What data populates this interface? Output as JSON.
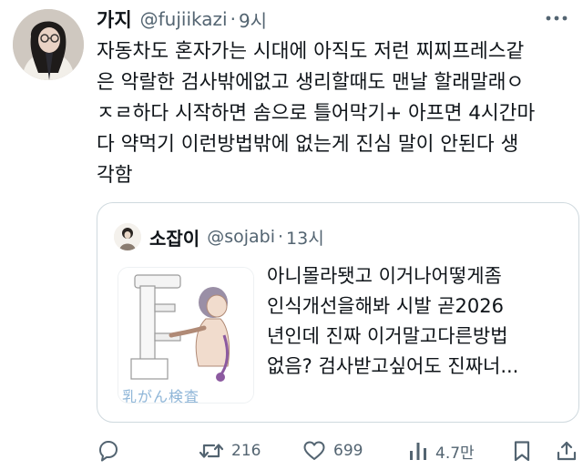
{
  "tweet": {
    "display_name": "가지",
    "handle": "@fujiikazi",
    "separator": "·",
    "time": "9시",
    "text": "자동차도 혼자가는 시대에 아직도 저런 찌찌프레스같\n은 악랄한 검사밖에없고 생리할때도 맨날 할래말래ㅇ\nㅈㄹ하다 시작하면 솜으로 틀어막기+ 아프면 4시간마\n다 약먹기 이런방법밖에 없는게 진심 말이 안된다 생\n각함"
  },
  "quote": {
    "display_name": "소잡이",
    "handle": "@sojabi",
    "separator": "·",
    "time": "13시",
    "text": "아니몰라됏고 이거나어떻게좀\n인식개선을해봐 시발  곧2026\n년인데 진짜 이거말고다른방법\n없음? 검사받고싶어도 진짜너...",
    "media_caption": "乳がん検査"
  },
  "actions": {
    "reply": {
      "icon": "reply-icon",
      "count": ""
    },
    "retweet": {
      "icon": "retweet-icon",
      "count": "216"
    },
    "like": {
      "icon": "heart-icon",
      "count": "699"
    },
    "views": {
      "icon": "views-icon",
      "count": "4.7만"
    },
    "bookmark": {
      "icon": "bookmark-icon",
      "count": ""
    },
    "share": {
      "icon": "share-icon",
      "count": ""
    }
  },
  "colors": {
    "text_primary": "#0f1419",
    "text_secondary": "#536471",
    "border": "#cfd9de"
  }
}
